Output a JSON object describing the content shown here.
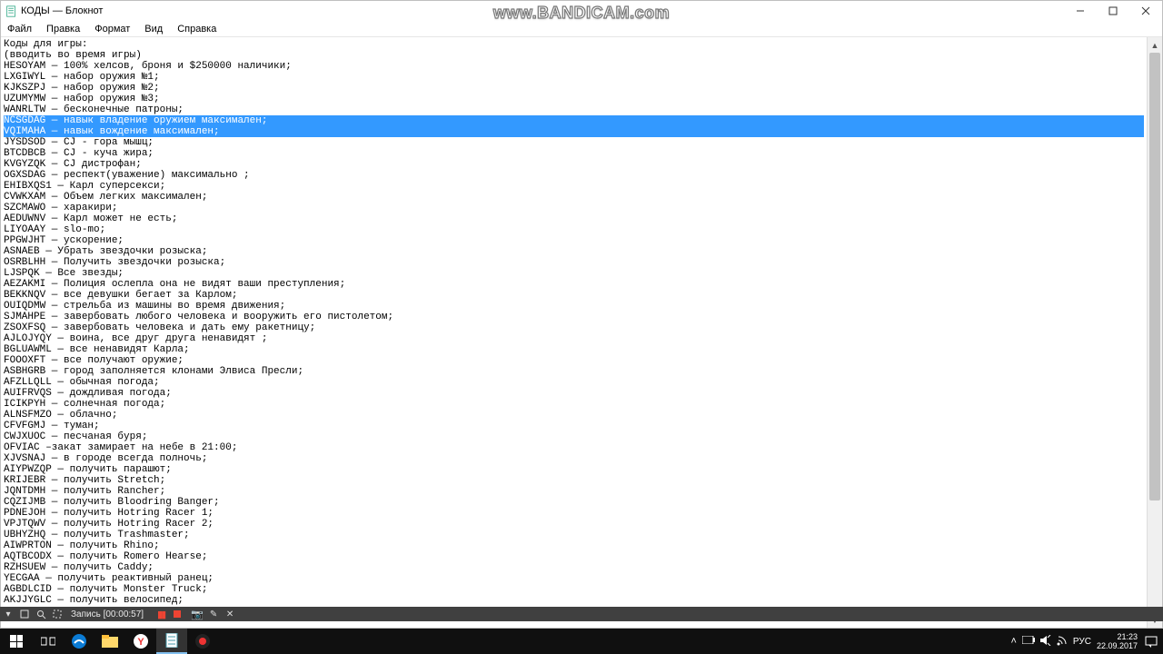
{
  "window": {
    "title": "КОДЫ — Блокнот",
    "menus": [
      "Файл",
      "Правка",
      "Формат",
      "Вид",
      "Справка"
    ]
  },
  "watermark": "www.BANDICAM.com",
  "document": {
    "header1": "Коды для игры:",
    "header2": "(вводить во время игры)",
    "lines": [
      "HESOYAM — 100% хелсов, броня и $250000 наличики;",
      "LXGIWYL — набор оружия №1;",
      "KJKSZPJ — набор оружия №2;",
      "UZUMYMW — набор оружия №3;",
      "WANRLTW — бесконечные патроны;"
    ],
    "selected": [
      "NCSGDAG — навык владение оружием максимален;",
      "VQIMAHA — навык вождение максимален;"
    ],
    "lines2": [
      "JYSDSOD — CJ - гора мышц;",
      "BTCDBCB — CJ - куча жира;",
      "KVGYZQK — CJ дистрофан;",
      "OGXSDAG — респект(уважение) максимально ;",
      "EHIBXQS1 — Карл суперсекси;",
      "CVWKXAM — Объем легких максимален;",
      "SZCMAWO — харакири;",
      "AEDUWNV — Карл может не есть;",
      "LIYOAAY — slo-mo;",
      "PPGWJHT — ускорение;",
      "ASNAEB — Убрать звездочки розыска;",
      "OSRBLHH — Получить звездочки розыска;",
      "LJSPQK — Все звезды;",
      "AEZAKMI — Полиция ослепла она не видят ваши преступления;",
      "BEKKNQV — все девушки бегает за Карлом;",
      "OUIQDMW — стрельба из машины во время движения;",
      "SJMAHPE — завербовать любого человека и вооружить его пистолетом;",
      "ZSOXFSQ — завербовать человека и дать ему ракетницу;",
      "AJLOJYQY — воина, все друг друга ненавидят ;",
      "BGLUAWML — все ненавидят Карла;",
      "FOOOXFT — все получают оружие;",
      "ASBHGRB — город заполняется клонами Элвиса Пресли;",
      "AFZLLQLL — обычная погода;",
      "AUIFRVQS — дождливая погода;",
      "ICIKPYH — солнечная погода;",
      "ALNSFMZO — облачно;",
      "CFVFGMJ — туман;",
      "CWJXUOC — песчаная буря;",
      "OFVIAC –закат замирает на небе в 21:00;",
      "XJVSNAJ — в городе всегда полночь;",
      "AIYPWZQP — получить парашют;",
      "KRIJEBR — получить Stretch;",
      "JQNTDMH — получить Rancher;",
      "CQZIJMB — получить Bloodring Banger;",
      "PDNEJOH — получить Hotring Racer 1;",
      "VPJTQWV — получить Hotring Racer 2;",
      "UBHYZHQ — получить Trashmaster;",
      "AIWPRTON — получить Rhino;",
      "AQTBCODX — получить Romero Hearse;",
      "RZHSUEW — получить Caddy;",
      "YECGAA — получить реактивный ранец;",
      "AGBDLCID — получить Monster Truck;",
      "AKJJYGLC — получить велосипед;"
    ]
  },
  "recbar": {
    "label": "Запись [00:00:57]"
  },
  "tray": {
    "lang": "РУС",
    "time": "21:23",
    "date": "22.09.2017"
  }
}
